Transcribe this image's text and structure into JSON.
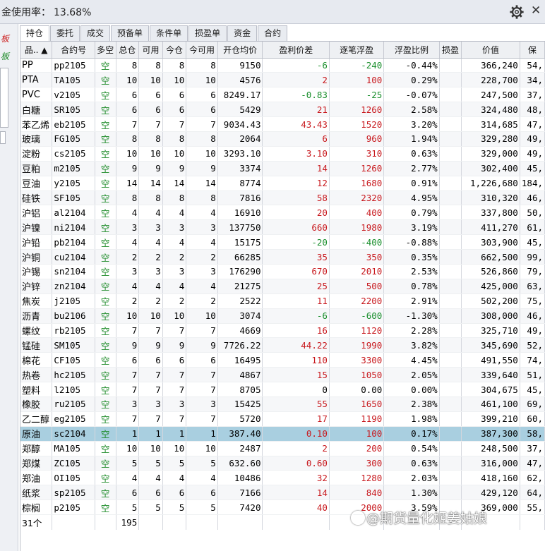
{
  "header": {
    "usage_label": "金使用率：",
    "usage_value": "13.68%",
    "close_glyph": "✕"
  },
  "left_panel": {
    "red_mark": "板",
    "green_mark": "板"
  },
  "tabs": [
    "持仓",
    "委托",
    "成交",
    "预备单",
    "条件单",
    "损盈单",
    "资金",
    "合约"
  ],
  "active_tab": 0,
  "columns": [
    "品.. ▲",
    "合约号",
    "多空",
    "总仓",
    "可用",
    "今仓",
    "今可用",
    "开仓均价",
    "盈利价差",
    "逐笔浮盈",
    "浮盈比例",
    "损盈",
    "价值",
    "保"
  ],
  "rows": [
    [
      "PP",
      "pp2105",
      "空",
      "8",
      "8",
      "8",
      "8",
      "9150",
      "-6",
      "-240",
      "-0.44%",
      "",
      "366,240",
      "54,"
    ],
    [
      "PTA",
      "TA105",
      "空",
      "10",
      "10",
      "10",
      "10",
      "4576",
      "2",
      "100",
      "0.29%",
      "",
      "228,700",
      "34,"
    ],
    [
      "PVC",
      "v2105",
      "空",
      "6",
      "6",
      "6",
      "6",
      "8249.17",
      "-0.83",
      "-25",
      "-0.07%",
      "",
      "247,500",
      "37,"
    ],
    [
      "白糖",
      "SR105",
      "空",
      "6",
      "6",
      "6",
      "6",
      "5429",
      "21",
      "1260",
      "2.58%",
      "",
      "324,480",
      "48,"
    ],
    [
      "苯乙烯",
      "eb2105",
      "空",
      "7",
      "7",
      "7",
      "7",
      "9034.43",
      "43.43",
      "1520",
      "3.20%",
      "",
      "314,685",
      "47,"
    ],
    [
      "玻璃",
      "FG105",
      "空",
      "8",
      "8",
      "8",
      "8",
      "2064",
      "6",
      "960",
      "1.94%",
      "",
      "329,280",
      "49,"
    ],
    [
      "淀粉",
      "cs2105",
      "空",
      "10",
      "10",
      "10",
      "10",
      "3293.10",
      "3.10",
      "310",
      "0.63%",
      "",
      "329,000",
      "49,"
    ],
    [
      "豆粕",
      "m2105",
      "空",
      "9",
      "9",
      "9",
      "9",
      "3374",
      "14",
      "1260",
      "2.77%",
      "",
      "302,400",
      "45,"
    ],
    [
      "豆油",
      "y2105",
      "空",
      "14",
      "14",
      "14",
      "14",
      "8774",
      "12",
      "1680",
      "0.91%",
      "",
      "1,226,680",
      "184,"
    ],
    [
      "硅铁",
      "SF105",
      "空",
      "8",
      "8",
      "8",
      "8",
      "7816",
      "58",
      "2320",
      "4.95%",
      "",
      "310,320",
      "46,"
    ],
    [
      "沪铝",
      "al2104",
      "空",
      "4",
      "4",
      "4",
      "4",
      "16910",
      "20",
      "400",
      "0.79%",
      "",
      "337,800",
      "50,"
    ],
    [
      "沪镍",
      "ni2104",
      "空",
      "3",
      "3",
      "3",
      "3",
      "137750",
      "660",
      "1980",
      "3.19%",
      "",
      "411,270",
      "61,"
    ],
    [
      "沪铅",
      "pb2104",
      "空",
      "4",
      "4",
      "4",
      "4",
      "15175",
      "-20",
      "-400",
      "-0.88%",
      "",
      "303,900",
      "45,"
    ],
    [
      "沪铜",
      "cu2104",
      "空",
      "2",
      "2",
      "2",
      "2",
      "66285",
      "35",
      "350",
      "0.35%",
      "",
      "662,500",
      "99,"
    ],
    [
      "沪锡",
      "sn2104",
      "空",
      "3",
      "3",
      "3",
      "3",
      "176290",
      "670",
      "2010",
      "2.53%",
      "",
      "526,860",
      "79,"
    ],
    [
      "沪锌",
      "zn2104",
      "空",
      "4",
      "4",
      "4",
      "4",
      "21275",
      "25",
      "500",
      "0.78%",
      "",
      "425,000",
      "63,"
    ],
    [
      "焦炭",
      "j2105",
      "空",
      "2",
      "2",
      "2",
      "2",
      "2522",
      "11",
      "2200",
      "2.91%",
      "",
      "502,200",
      "75,"
    ],
    [
      "沥青",
      "bu2106",
      "空",
      "10",
      "10",
      "10",
      "10",
      "3074",
      "-6",
      "-600",
      "-1.30%",
      "",
      "308,000",
      "46,"
    ],
    [
      "螺纹",
      "rb2105",
      "空",
      "7",
      "7",
      "7",
      "7",
      "4669",
      "16",
      "1120",
      "2.28%",
      "",
      "325,710",
      "49,"
    ],
    [
      "锰硅",
      "SM105",
      "空",
      "9",
      "9",
      "9",
      "9",
      "7726.22",
      "44.22",
      "1990",
      "3.82%",
      "",
      "345,690",
      "52,"
    ],
    [
      "棉花",
      "CF105",
      "空",
      "6",
      "6",
      "6",
      "6",
      "16495",
      "110",
      "3300",
      "4.45%",
      "",
      "491,550",
      "74,"
    ],
    [
      "热卷",
      "hc2105",
      "空",
      "7",
      "7",
      "7",
      "7",
      "4867",
      "15",
      "1050",
      "2.05%",
      "",
      "339,640",
      "51,"
    ],
    [
      "塑料",
      "l2105",
      "空",
      "7",
      "7",
      "7",
      "7",
      "8705",
      "0",
      "0.00",
      "0.00%",
      "",
      "304,675",
      "45,"
    ],
    [
      "橡胶",
      "ru2105",
      "空",
      "3",
      "3",
      "3",
      "3",
      "15425",
      "55",
      "1650",
      "2.38%",
      "",
      "461,100",
      "69,"
    ],
    [
      "乙二醇",
      "eg2105",
      "空",
      "7",
      "7",
      "7",
      "7",
      "5720",
      "17",
      "1190",
      "1.98%",
      "",
      "399,210",
      "60,"
    ],
    [
      "原油",
      "sc2104",
      "空",
      "1",
      "1",
      "1",
      "1",
      "387.40",
      "0.10",
      "100",
      "0.17%",
      "",
      "387,300",
      "58,"
    ],
    [
      "郑醇",
      "MA105",
      "空",
      "10",
      "10",
      "10",
      "10",
      "2487",
      "2",
      "200",
      "0.54%",
      "",
      "248,500",
      "37,"
    ],
    [
      "郑煤",
      "ZC105",
      "空",
      "5",
      "5",
      "5",
      "5",
      "632.60",
      "0.60",
      "300",
      "0.63%",
      "",
      "316,000",
      "47,"
    ],
    [
      "郑油",
      "OI105",
      "空",
      "4",
      "4",
      "4",
      "4",
      "10486",
      "32",
      "1280",
      "2.03%",
      "",
      "418,160",
      "62,"
    ],
    [
      "纸浆",
      "sp2105",
      "空",
      "6",
      "6",
      "6",
      "6",
      "7166",
      "14",
      "840",
      "1.30%",
      "",
      "429,120",
      "64,"
    ],
    [
      "棕榈",
      "p2105",
      "空",
      "5",
      "5",
      "5",
      "5",
      "7420",
      "40",
      "2000",
      "3.59%",
      "",
      "369,000",
      "55,"
    ]
  ],
  "selected_row": 25,
  "footer": {
    "count": "31个",
    "total_position": "195"
  },
  "watermark": "@期货量化姬姜姑娘",
  "colors": {
    "profit": "#c8191e",
    "loss": "#1a8f2d",
    "direction": "#1f8c2a",
    "selected_row": "#a9cfe0"
  }
}
